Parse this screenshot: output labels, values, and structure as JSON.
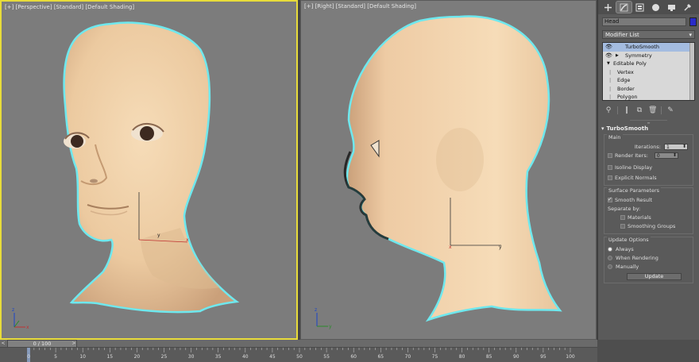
{
  "viewports": {
    "left": {
      "bracket": "[+]",
      "view": "[Perspective]",
      "shading_mode": "[Standard]",
      "render_mode": "[Default Shading]"
    },
    "right": {
      "bracket": "[+]",
      "view": "[Right]",
      "shading_mode": "[Standard]",
      "render_mode": "[Default Shading]"
    },
    "gizmo_labels": {
      "x": "x",
      "y": "y",
      "z": "z"
    }
  },
  "panel": {
    "tabs": [
      "create-icon",
      "modify-icon",
      "hierarchy-icon",
      "motion-icon",
      "display-icon",
      "utilities-icon"
    ],
    "object_name": "Head",
    "object_color": "#2a2ac8",
    "modifier_list_label": "Modifier List",
    "stack": [
      {
        "label": "TurboSmooth",
        "selected": true
      },
      {
        "label": "Symmetry",
        "selected": false
      },
      {
        "label": "Editable Poly",
        "selected": false
      },
      {
        "label": "Vertex",
        "selected": false
      },
      {
        "label": "Edge",
        "selected": false
      },
      {
        "label": "Border",
        "selected": false
      },
      {
        "label": "Polygon",
        "selected": false
      }
    ],
    "rollout_title": "TurboSmooth",
    "main": {
      "title": "Main",
      "iterations_label": "Iterations:",
      "iterations_value": "1",
      "render_iters_label": "Render Iters:",
      "render_iters_value": "0",
      "isoline_label": "Isoline Display",
      "explicit_normals_label": "Explicit Normals"
    },
    "surface": {
      "title": "Surface Parameters",
      "smooth_result_label": "Smooth Result",
      "separate_by_label": "Separate by:",
      "materials_label": "Materials",
      "smoothing_groups_label": "Smoothing Groups"
    },
    "update": {
      "title": "Update Options",
      "always_label": "Always",
      "when_rendering_label": "When Rendering",
      "manually_label": "Manually",
      "update_button": "Update"
    }
  },
  "timeline": {
    "frame_readout": "0 / 100",
    "prev_label": "<",
    "next_label": ">",
    "ticks": [
      "0",
      "5",
      "10",
      "15",
      "20",
      "25",
      "30",
      "35",
      "40",
      "45",
      "50",
      "55",
      "60",
      "65",
      "70",
      "75",
      "80",
      "85",
      "90",
      "95",
      "100"
    ]
  },
  "colors": {
    "selection_outline": "#6ee8ee",
    "skin": "#efcfa7",
    "active_viewport_border": "#e8dc3a"
  }
}
